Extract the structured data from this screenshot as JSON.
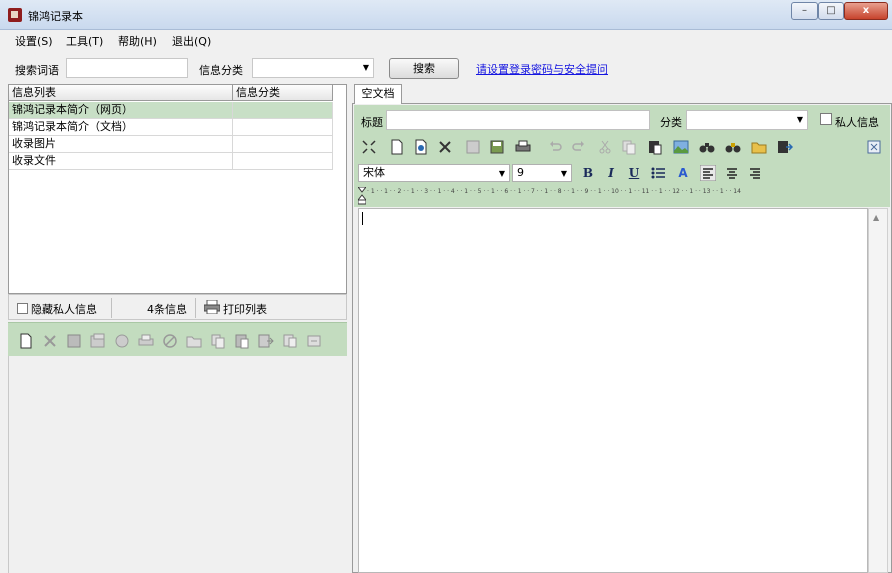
{
  "window": {
    "title": "锦鸿记录本",
    "minimize": "–",
    "maximize": "□",
    "close": "x"
  },
  "menu": [
    {
      "label": "设置(S)"
    },
    {
      "label": "工具(T)"
    },
    {
      "label": "帮助(H)"
    },
    {
      "label": "退出(Q)"
    }
  ],
  "search": {
    "term_label": "搜索词语",
    "term_value": "",
    "category_label": "信息分类",
    "category_value": "",
    "button_label": "搜索",
    "register_link": "请设置登录密码与安全提问"
  },
  "list": {
    "headers": [
      "信息列表",
      "信息分类"
    ],
    "rows": [
      {
        "title": "锦鸿记录本简介（网页）",
        "category": "",
        "selected": true
      },
      {
        "title": "锦鸿记录本简介（文档）",
        "category": "",
        "selected": false
      },
      {
        "title": "收录图片",
        "category": "",
        "selected": false
      },
      {
        "title": "收录文件",
        "category": "",
        "selected": false
      }
    ],
    "hide_private_label": "隐藏私人信息",
    "count_label": "4条信息",
    "print_label": "打印列表"
  },
  "left_toolbar_icons": [
    "new-icon",
    "delete-icon",
    "save-icon",
    "save-as-icon",
    "record-icon",
    "print-icon",
    "cancel-icon",
    "open-folder-icon",
    "copy-icon",
    "paste-icon",
    "export-icon",
    "move-icon",
    "refresh-icon"
  ],
  "document": {
    "tab_label": "空文档",
    "title_label": "标题",
    "title_value": "",
    "category_label": "分类",
    "category_value": "",
    "private_label": "私人信息",
    "font_value": "宋体",
    "size_value": "9",
    "ruler_text": "· 1 · · 1 · · 2 · · 1 · · 3 · · 1 · · 4 · · 1 · · 5 · · 1 · · 6 · · 1 · · 7 · · 1 · · 8 · · 1 · · 9 · · 1 · · 10 · · 1 · · 11 · · 1 · · 12 · · 1 · · 13 · · 1 · · 14"
  },
  "editor_toolbar_icons": [
    "fullscreen-icon",
    "new-doc-icon",
    "open-doc-icon",
    "delete-icon",
    "save-icon",
    "save-disk-icon",
    "print-icon",
    "undo-icon",
    "redo-icon",
    "cut-icon",
    "copy-icon",
    "paste-icon",
    "insert-image-icon",
    "find-icon",
    "find-replace-icon",
    "open-folder-icon",
    "export-icon",
    "close-pane-icon"
  ],
  "format_buttons": {
    "bold": "B",
    "italic": "I",
    "underline": "U",
    "color": "A"
  }
}
